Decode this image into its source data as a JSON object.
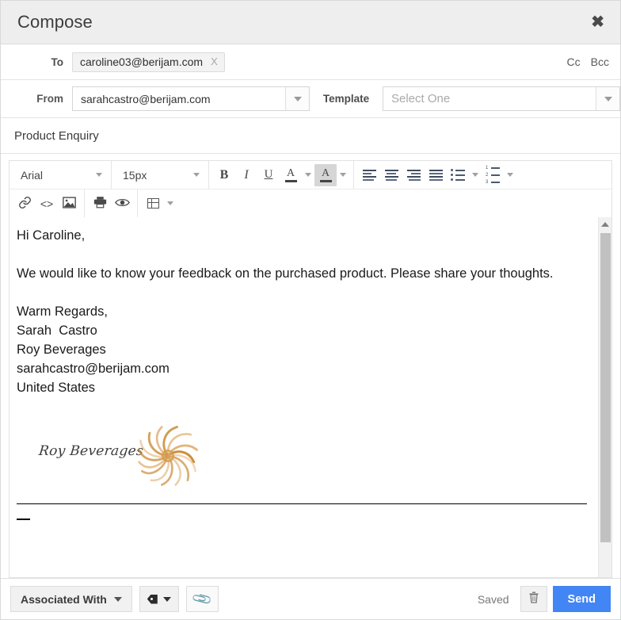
{
  "header": {
    "title": "Compose",
    "close_icon": "close-icon"
  },
  "to_row": {
    "label": "To",
    "recipient": "caroline03@berijam.com",
    "remove_label": "X",
    "cc_label": "Cc",
    "bcc_label": "Bcc"
  },
  "from_row": {
    "label": "From",
    "from_value": "sarahcastro@berijam.com",
    "template_label": "Template",
    "template_placeholder": "Select One"
  },
  "subject": {
    "value": "Product Enquiry"
  },
  "toolbar": {
    "font_family": "Arial",
    "font_size": "15px",
    "bold": "B",
    "italic": "I",
    "underline": "U",
    "text_color": "A",
    "highlight_color": "A",
    "align_left": "align-left",
    "align_center": "align-center",
    "align_right": "align-right",
    "align_justify": "align-justify",
    "bullet_list": "bullet-list",
    "numbered_list": "numbered-list",
    "link": "link",
    "source_code": "<>",
    "insert_image": "image",
    "print": "print",
    "preview": "preview",
    "table": "table"
  },
  "body": {
    "greeting": "Hi Caroline,",
    "paragraph": "We would like to know your feedback on the purchased product. Please share your thoughts.",
    "signature": "Warm Regards,\nSarah  Castro\nRoy Beverages\nsarahcastro@berijam.com\nUnited States",
    "logo_text": "Roy Beverages"
  },
  "footer": {
    "associated_with": "Associated With",
    "tag_icon": "tag-icon",
    "attach_icon": "paperclip-icon",
    "status": "Saved",
    "delete_icon": "trash-icon",
    "send_label": "Send"
  },
  "colors": {
    "send_button": "#4285f4",
    "header_bg": "#eeeeee",
    "logo_accent": "#d59b4e"
  }
}
